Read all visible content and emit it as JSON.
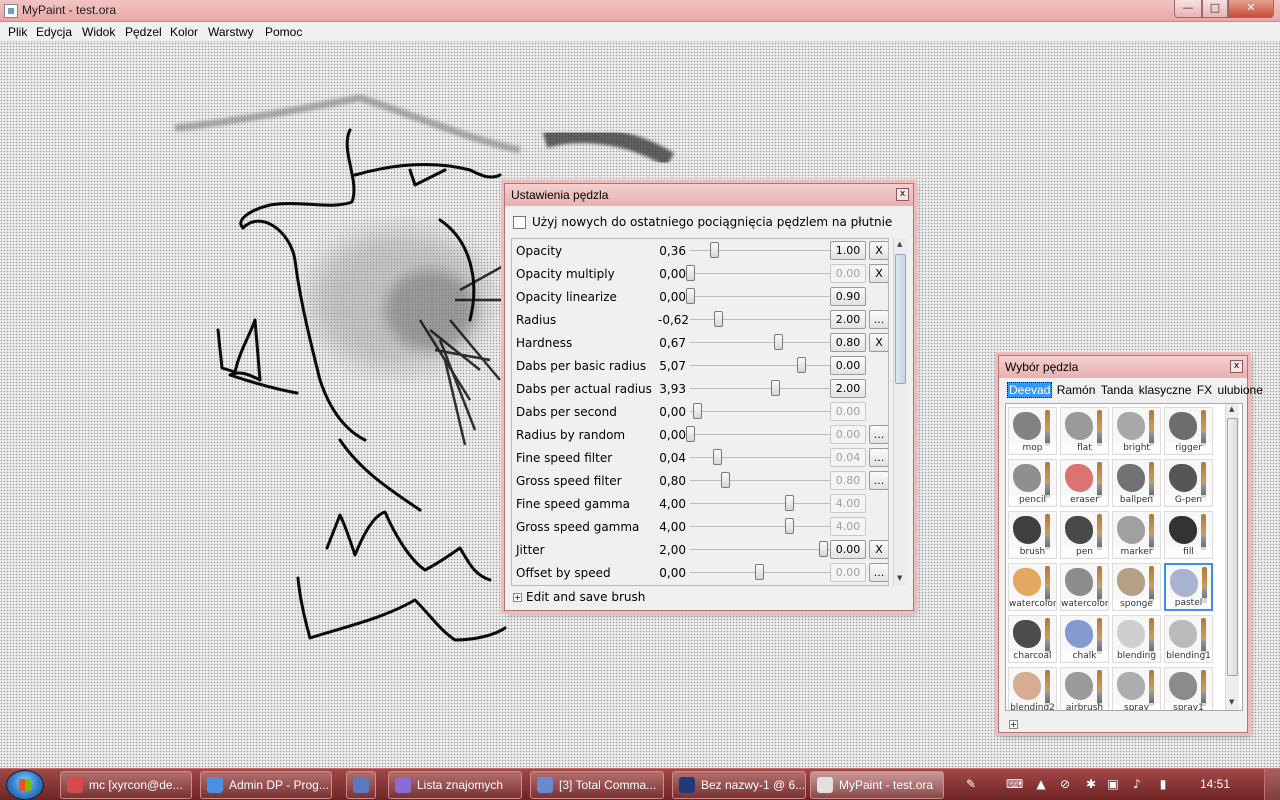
{
  "window": {
    "title": "MyPaint - test.ora",
    "min": "—",
    "max": "□",
    "close": "✕"
  },
  "menu": [
    "Plik",
    "Edycja",
    "Widok",
    "Pędzel",
    "Kolor",
    "Warstwy",
    "Pomoc"
  ],
  "brush_settings": {
    "title": "Ustawienia pędzla",
    "close": "x",
    "use_new_label": "Użyj nowych do ostatniego pociągnięcia pędzlem na płutnie",
    "edit_save_label": "Edit and save brush",
    "rows": [
      {
        "label": "Opacity",
        "value": "0,36",
        "level": 0.17,
        "base": "1.00",
        "base_dim": false,
        "extra": "X"
      },
      {
        "label": "Opacity multiply",
        "value": "0,00",
        "level": 0.0,
        "base": "0.00",
        "base_dim": true,
        "extra": "X"
      },
      {
        "label": "Opacity linearize",
        "value": "0,00",
        "level": 0.0,
        "base": "0.90",
        "base_dim": false,
        "extra": ""
      },
      {
        "label": "Radius",
        "value": "-0,62",
        "level": 0.2,
        "base": "2.00",
        "base_dim": false,
        "extra": "..."
      },
      {
        "label": "Hardness",
        "value": "0,67",
        "level": 0.63,
        "base": "0.80",
        "base_dim": false,
        "extra": "X"
      },
      {
        "label": "Dabs per basic radius",
        "value": "5,07",
        "level": 0.79,
        "base": "0.00",
        "base_dim": false,
        "extra": ""
      },
      {
        "label": "Dabs per actual radius",
        "value": "3,93",
        "level": 0.61,
        "base": "2.00",
        "base_dim": false,
        "extra": ""
      },
      {
        "label": "Dabs per second",
        "value": "0,00",
        "level": 0.05,
        "base": "0.00",
        "base_dim": true,
        "extra": ""
      },
      {
        "label": "Radius by random",
        "value": "0,00",
        "level": 0.0,
        "base": "0.00",
        "base_dim": true,
        "extra": "..."
      },
      {
        "label": "Fine speed filter",
        "value": "0,04",
        "level": 0.19,
        "base": "0.04",
        "base_dim": true,
        "extra": "..."
      },
      {
        "label": "Gross speed filter",
        "value": "0,80",
        "level": 0.25,
        "base": "0.80",
        "base_dim": true,
        "extra": "..."
      },
      {
        "label": "Fine speed gamma",
        "value": "4,00",
        "level": 0.71,
        "base": "4.00",
        "base_dim": true,
        "extra": ""
      },
      {
        "label": "Gross speed gamma",
        "value": "4,00",
        "level": 0.71,
        "base": "4.00",
        "base_dim": true,
        "extra": ""
      },
      {
        "label": "Jitter",
        "value": "2,00",
        "level": 0.95,
        "base": "0.00",
        "base_dim": false,
        "extra": "X"
      },
      {
        "label": "Offset by speed",
        "value": "0,00",
        "level": 0.49,
        "base": "0.00",
        "base_dim": true,
        "extra": "..."
      }
    ]
  },
  "brush_picker": {
    "title": "Wybór pędzla",
    "close": "x",
    "tabs": [
      "Deevad",
      "Ramón",
      "Tanda",
      "klasyczne",
      "FX",
      "ulubione"
    ],
    "active_tab": "Deevad",
    "selected_brush": "pastel",
    "brushes": [
      {
        "name": "mop",
        "color": "#6e6e6e"
      },
      {
        "name": "flat",
        "color": "#8a8a8a"
      },
      {
        "name": "bright",
        "color": "#9a9a9a"
      },
      {
        "name": "rigger",
        "color": "#555555"
      },
      {
        "name": "pencil",
        "color": "#7c7c7c"
      },
      {
        "name": "eraser",
        "color": "#d85a5a"
      },
      {
        "name": "ballpen",
        "color": "#5a5a5a"
      },
      {
        "name": "G-pen",
        "color": "#3a3a3a"
      },
      {
        "name": "brush",
        "color": "#1e1e1e"
      },
      {
        "name": "pen",
        "color": "#2a2a2a"
      },
      {
        "name": "marker",
        "color": "#909090"
      },
      {
        "name": "fill",
        "color": "#101010"
      },
      {
        "name": "watercolor",
        "color": "#e09a45"
      },
      {
        "name": "watercolor1",
        "color": "#7a7a7a"
      },
      {
        "name": "sponge",
        "color": "#a89070"
      },
      {
        "name": "pastel",
        "color": "#9aa8c8"
      },
      {
        "name": "charcoal",
        "color": "#2e2e2e"
      },
      {
        "name": "chalk",
        "color": "#7088c8"
      },
      {
        "name": "blending",
        "color": "#c8c8c8"
      },
      {
        "name": "blending1",
        "color": "#b0b0b0"
      },
      {
        "name": "blending2",
        "color": "#d0a080"
      },
      {
        "name": "airbrush",
        "color": "#8a8a8a"
      },
      {
        "name": "spray",
        "color": "#a0a0a0"
      },
      {
        "name": "spray1",
        "color": "#787878"
      }
    ]
  },
  "taskbar": {
    "tasks": [
      {
        "label": "mc [xyrcon@de...",
        "icon_color": "#d64a4a",
        "active": false
      },
      {
        "label": "Admin DP - Prog...",
        "icon_color": "#4a90e2",
        "active": false
      },
      {
        "label": "",
        "icon_color": "#5a7abf",
        "active": false
      },
      {
        "label": "Lista znajomych",
        "icon_color": "#8a6ad6",
        "active": false
      },
      {
        "label": "[3] Total Comma...",
        "icon_color": "#6a8ad0",
        "active": false
      },
      {
        "label": "Bez nazwy-1 @ 6...",
        "icon_color": "#1f3a7a",
        "active": false
      },
      {
        "label": "MyPaint - test.ora",
        "icon_color": "#e0e0e0",
        "active": true
      }
    ],
    "clock": "14:51"
  }
}
